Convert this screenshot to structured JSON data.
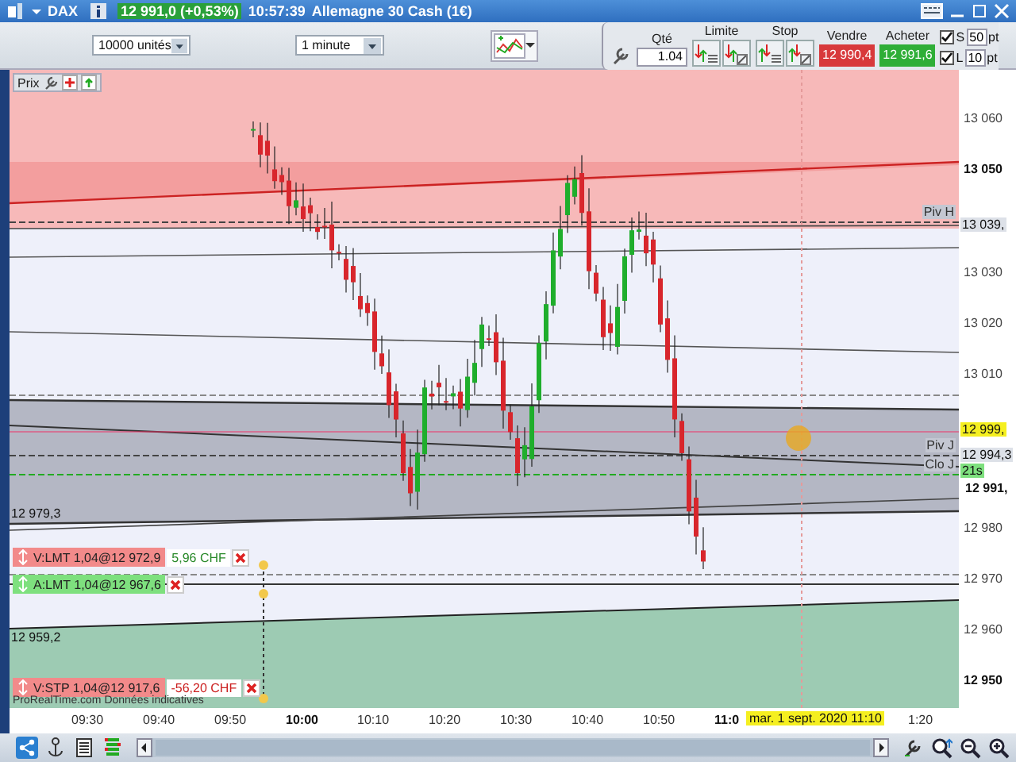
{
  "title_bar": {
    "symbol": "DAX",
    "quote": "12 991,0 (+0,53%)",
    "time": "10:57:39",
    "instrument": "Allemagne 30 Cash (1€)"
  },
  "toolbar": {
    "quantity": "10000 unités",
    "interval": "1 minute",
    "qty_label": "Qté",
    "qty_value": "1.04",
    "limit_label": "Limite",
    "stop_label": "Stop",
    "sell_label": "Vendre",
    "sell_price": "12 990,4",
    "buy_label": "Acheter",
    "buy_price": "12 991,6",
    "checks": [
      {
        "label": "S",
        "checked": true,
        "value": "50",
        "unit": "pt"
      },
      {
        "label": "L",
        "checked": true,
        "value": "10",
        "unit": "pt"
      }
    ]
  },
  "chart": {
    "price_label": "Prix",
    "left_labels": [
      "12 979,3",
      "12 959,2"
    ],
    "line_labels": [
      {
        "text": "Piv H",
        "kind": "high"
      },
      {
        "text": "Piv J",
        "kind": "pivot"
      },
      {
        "text": "Clo J",
        "kind": "close"
      }
    ],
    "orders": [
      {
        "kind": "sell",
        "text": "V:LMT 1,04@12 972,9",
        "pnl": {
          "text": "5,96 CHF",
          "color": "#2a8a2a"
        }
      },
      {
        "kind": "buy",
        "text": "A:LMT 1,04@12 967,6"
      },
      {
        "kind": "sell",
        "text": "V:STP 1,04@12 917,6",
        "pnl": {
          "text": "-56,20 CHF",
          "color": "#cc2222"
        }
      }
    ],
    "footer": "ProRealTime.com Données indicatives",
    "y_labels": [
      {
        "text": "13 060",
        "bold": false
      },
      {
        "text": "13 050",
        "bold": true
      },
      {
        "text": "13 030",
        "bold": false
      },
      {
        "text": "13 020",
        "bold": false
      },
      {
        "text": "13 010",
        "bold": false
      },
      {
        "text": "12 980",
        "bold": false
      },
      {
        "text": "12 970",
        "bold": false
      },
      {
        "text": "12 960",
        "bold": false
      },
      {
        "text": "12 950",
        "bold": true
      }
    ],
    "tags": [
      {
        "text": "13 039,",
        "kind": "pivot"
      },
      {
        "text": "12 999,",
        "kind": "cursor"
      },
      {
        "text": "12 994,3",
        "kind": "pivot"
      },
      {
        "text": "21s",
        "kind": "timer"
      },
      {
        "text": "12 991,",
        "kind": "last"
      }
    ],
    "x_labels": [
      {
        "text": "09:30",
        "bold": false
      },
      {
        "text": "09:40",
        "bold": false
      },
      {
        "text": "09:50",
        "bold": false
      },
      {
        "text": "10:00",
        "bold": true
      },
      {
        "text": "10:10",
        "bold": false
      },
      {
        "text": "10:20",
        "bold": false
      },
      {
        "text": "10:30",
        "bold": false
      },
      {
        "text": "10:40",
        "bold": false
      },
      {
        "text": "10:50",
        "bold": false
      },
      {
        "text": "11:0",
        "bold": true
      },
      {
        "text": "1:20",
        "bold": false
      }
    ],
    "cursor_date": "mar. 1 sept. 2020 11:10"
  }
}
